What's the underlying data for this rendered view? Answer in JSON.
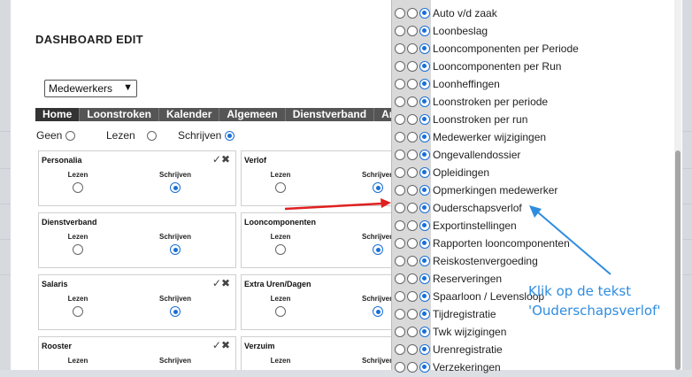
{
  "modal": {
    "title": "DASHBOARD EDIT",
    "select_value": "Medewerkers",
    "tabs": [
      "Home",
      "Loonstroken",
      "Kalender",
      "Algemeen",
      "Dienstverband",
      "Art"
    ],
    "global_perms": {
      "none": "Geen",
      "read": "Lezen",
      "write": "Schrijven"
    },
    "col_read": "Lezen",
    "col_write": "Schrijven",
    "cards": [
      {
        "title": "Personalia"
      },
      {
        "title": "Verlof"
      },
      {
        "title": "Dienstverband"
      },
      {
        "title": "Looncomponenten"
      },
      {
        "title": "Salaris"
      },
      {
        "title": "Extra Uren/Dagen"
      },
      {
        "title": "Rooster"
      },
      {
        "title": "Verzuim"
      }
    ]
  },
  "permission_list": [
    "Auto v/d zaak",
    "Loonbeslag",
    "Looncomponenten per Periode",
    "Looncomponenten per Run",
    "Loonheffingen",
    "Loonstroken per periode",
    "Loonstroken per run",
    "Medewerker wijzigingen",
    "Ongevallendossier",
    "Opleidingen",
    "Opmerkingen medewerker",
    "Ouderschapsverlof",
    "Exportinstellingen",
    "Rapporten looncomponenten",
    "Reiskostenvergoeding",
    "Reserveringen",
    "Spaarloon / Levensloop",
    "Tijdregistratie",
    "Twk wijzigingen",
    "Urenregistratie",
    "Verzekeringen"
  ],
  "annotation": {
    "line1": "Klik op de tekst",
    "line2": "'Ouderschapsverlof'"
  },
  "colors": {
    "arrow_red": "#e02020",
    "arrow_blue": "#2f8de0",
    "radio_on": "#1a6fd6"
  }
}
